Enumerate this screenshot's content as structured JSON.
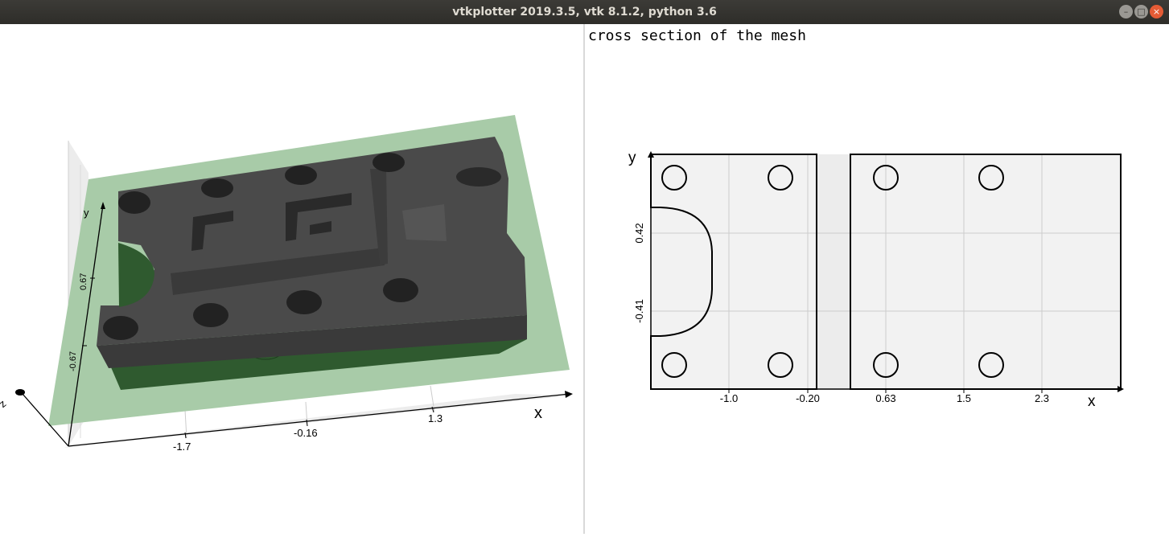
{
  "window": {
    "title": "vtkplotter 2019.3.5, vtk 8.1.2, python 3.6",
    "buttons": [
      "minimize",
      "maximize",
      "close"
    ]
  },
  "left_view": {
    "axes": {
      "x_label": "x",
      "y_label": "y",
      "z_label": "z",
      "x_ticks": [
        "-1.7",
        "-0.16",
        "1.3"
      ],
      "y_ticks": [
        "-0.67",
        "0.67"
      ]
    },
    "colors": {
      "mesh": "#4a4a4a",
      "plane": "#a8cba8",
      "section": "#2f5a2f"
    }
  },
  "right_view": {
    "caption": "cross section of the mesh",
    "axes": {
      "x_label": "x",
      "y_label": "y",
      "x_ticks": [
        "-1.0",
        "-0.20",
        "0.63",
        "1.5",
        "2.3"
      ],
      "y_ticks": [
        "0.42",
        "-0.41"
      ]
    },
    "colors": {
      "fill": "#f2f2f2",
      "outline": "#000000",
      "grid": "#cccccc"
    }
  }
}
